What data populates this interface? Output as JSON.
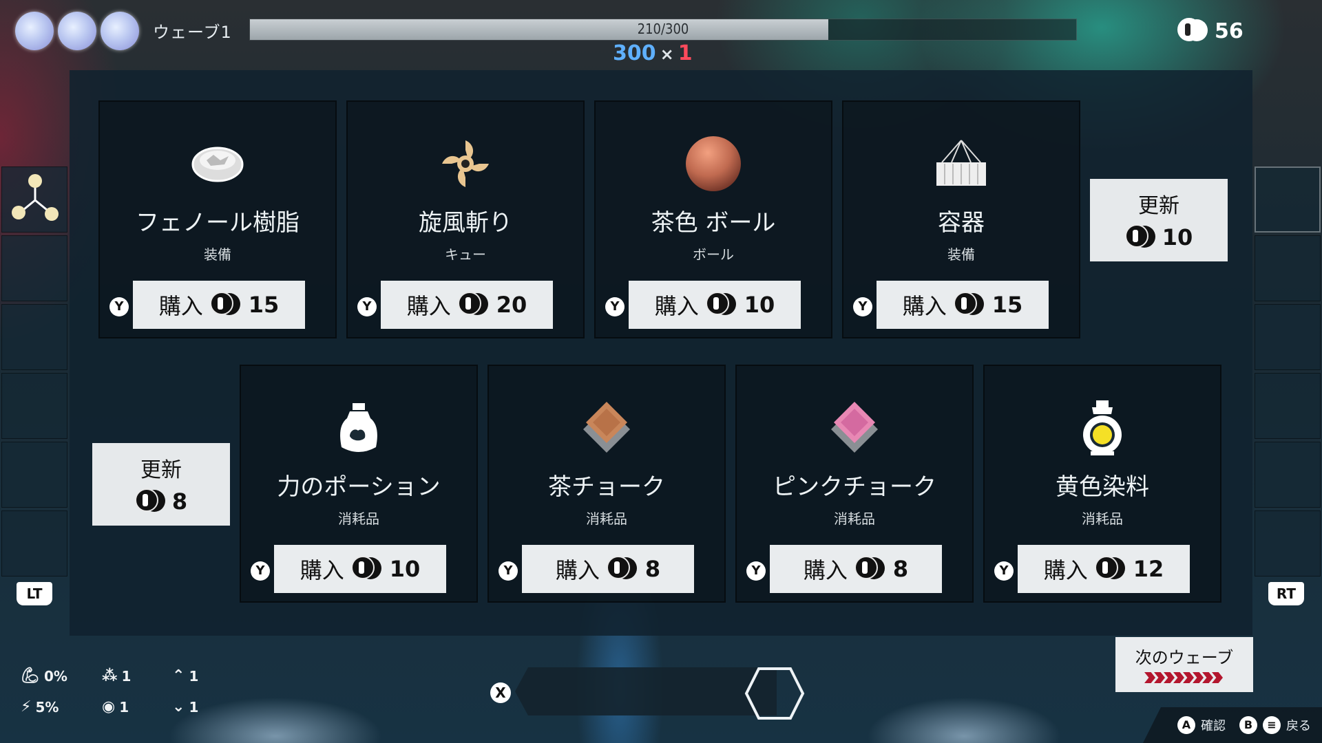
{
  "hud": {
    "lives": 3,
    "wave_label": "ウェーブ1",
    "progress_text": "210/300",
    "progress_value": 210,
    "progress_max": 300,
    "score": "300",
    "multiplier_sign": "×",
    "multiplier": "1",
    "money": "56"
  },
  "shop": {
    "row1": [
      {
        "name": "フェノール樹脂",
        "category": "装備",
        "icon": "disc-item-icon",
        "buy_label": "購入",
        "price": "15"
      },
      {
        "name": "旋風斬り",
        "category": "キュー",
        "icon": "whirlwind-icon",
        "buy_label": "購入",
        "price": "20"
      },
      {
        "name": "茶色 ボール",
        "category": "ボール",
        "icon": "brown-ball-icon",
        "buy_label": "購入",
        "price": "10"
      },
      {
        "name": "容器",
        "category": "装備",
        "icon": "container-icon",
        "buy_label": "購入",
        "price": "15"
      }
    ],
    "row2": [
      {
        "name": "力のポーション",
        "category": "消耗品",
        "icon": "potion-icon",
        "buy_label": "購入",
        "price": "10"
      },
      {
        "name": "茶チョーク",
        "category": "消耗品",
        "icon": "brown-chalk-icon",
        "buy_label": "購入",
        "price": "8"
      },
      {
        "name": "ピンクチョーク",
        "category": "消耗品",
        "icon": "pink-chalk-icon",
        "buy_label": "購入",
        "price": "8"
      },
      {
        "name": "黄色染料",
        "category": "消耗品",
        "icon": "yellow-dye-icon",
        "buy_label": "購入",
        "price": "12"
      }
    ],
    "buy_button_key": "Y",
    "refresh_top": {
      "label": "更新",
      "price": "10"
    },
    "refresh_bottom": {
      "label": "更新",
      "price": "8"
    }
  },
  "side": {
    "left_trigger": "LT",
    "right_trigger": "RT"
  },
  "stats": {
    "strength": "0%",
    "speed": "5%",
    "balls": "1",
    "vision": "1",
    "up": "1",
    "down": "1"
  },
  "bottom": {
    "x_key": "X",
    "next_wave_label": "次のウェーブ",
    "confirm_key": "A",
    "confirm_label": "確認",
    "back_key": "B",
    "back_label": "戻る"
  },
  "colors": {
    "combo_score": "#5fb0ff",
    "combo_multiplier": "#ff4a5c",
    "next_wave_arrows": "#b3162e"
  }
}
